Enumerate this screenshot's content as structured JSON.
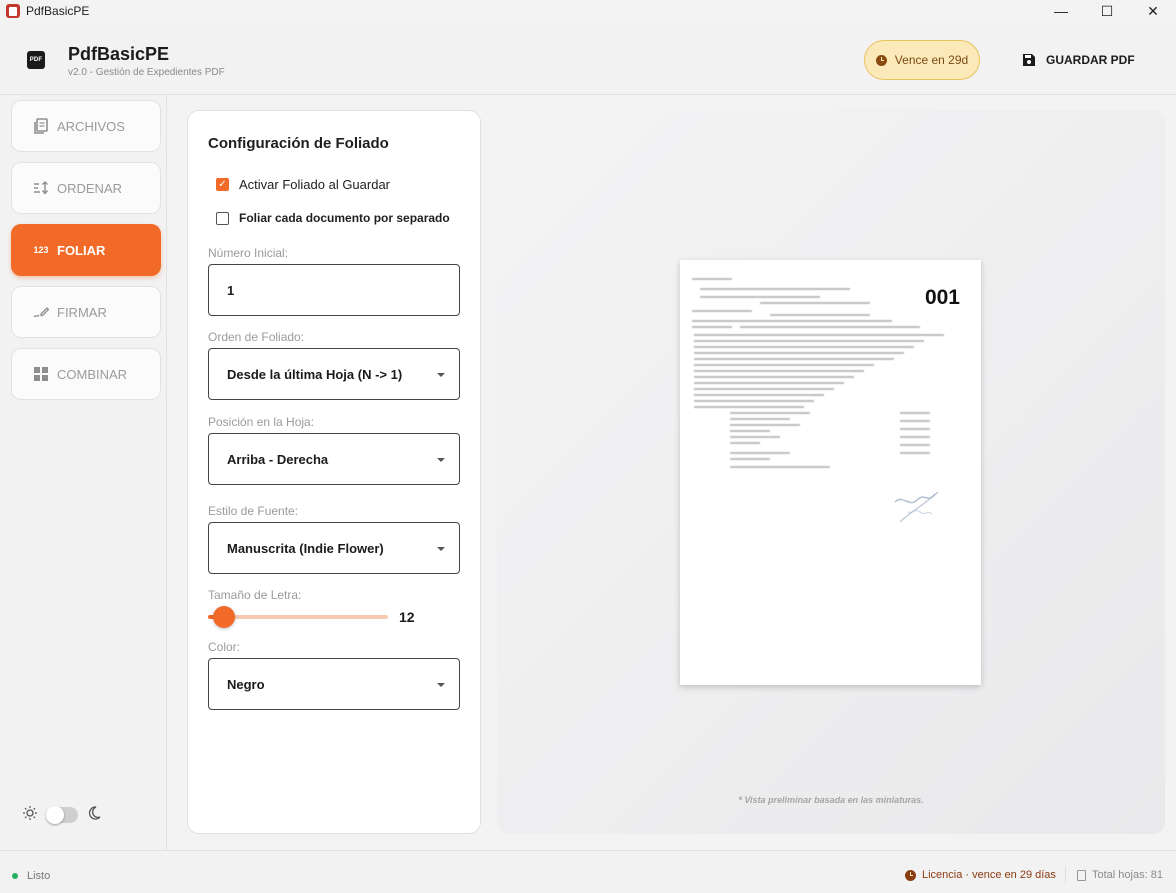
{
  "window": {
    "title": "PdfBasicPE",
    "minimize": "—",
    "maximize": "☐",
    "close": "✕"
  },
  "header": {
    "logo_text": "PDF",
    "app_name": "PdfBasicPE",
    "subtitle": "v2.0 - Gestión de Expedientes PDF",
    "expiry_badge": "Vence en 29d",
    "save_label": "GUARDAR PDF"
  },
  "sidebar": {
    "items": [
      {
        "label": "ARCHIVOS",
        "icon": "files-icon",
        "active": false
      },
      {
        "label": "ORDENAR",
        "icon": "sort-icon",
        "active": false
      },
      {
        "label": "FOLIAR",
        "icon": "numbering-icon",
        "active": true,
        "icon_text": "123"
      },
      {
        "label": "FIRMAR",
        "icon": "signature-icon",
        "active": false
      },
      {
        "label": "COMBINAR",
        "icon": "grid-icon",
        "active": false
      }
    ],
    "theme_mode": "light"
  },
  "config": {
    "title": "Configuración de Foliado",
    "activate_label": "Activar Foliado al Guardar",
    "activate_checked": true,
    "separate_label": "Foliar cada documento por separado",
    "separate_checked": false,
    "start_number_label": "Número Inicial:",
    "start_number_value": "1",
    "order_label": "Orden de Foliado:",
    "order_value": "Desde la última Hoja (N -> 1)",
    "position_label": "Posición en la Hoja:",
    "position_value": "Arriba - Derecha",
    "font_label": "Estilo de Fuente:",
    "font_value": "Manuscrita (Indie Flower)",
    "size_label": "Tamaño de Letra:",
    "size_value": "12",
    "size_fraction": 0.09,
    "color_label": "Color:",
    "color_value": "Negro"
  },
  "preview": {
    "folio_number": "001",
    "note": "* Vista preliminar basada en las miniaturas."
  },
  "status": {
    "ready": "Listo",
    "license": "Licencia · vence en 29 días",
    "total": "Total hojas: 81"
  },
  "colors": {
    "accent": "#f26a28",
    "badge_bg": "#fbe9b9",
    "ready": "#27ae60",
    "license": "#8a3b10"
  }
}
